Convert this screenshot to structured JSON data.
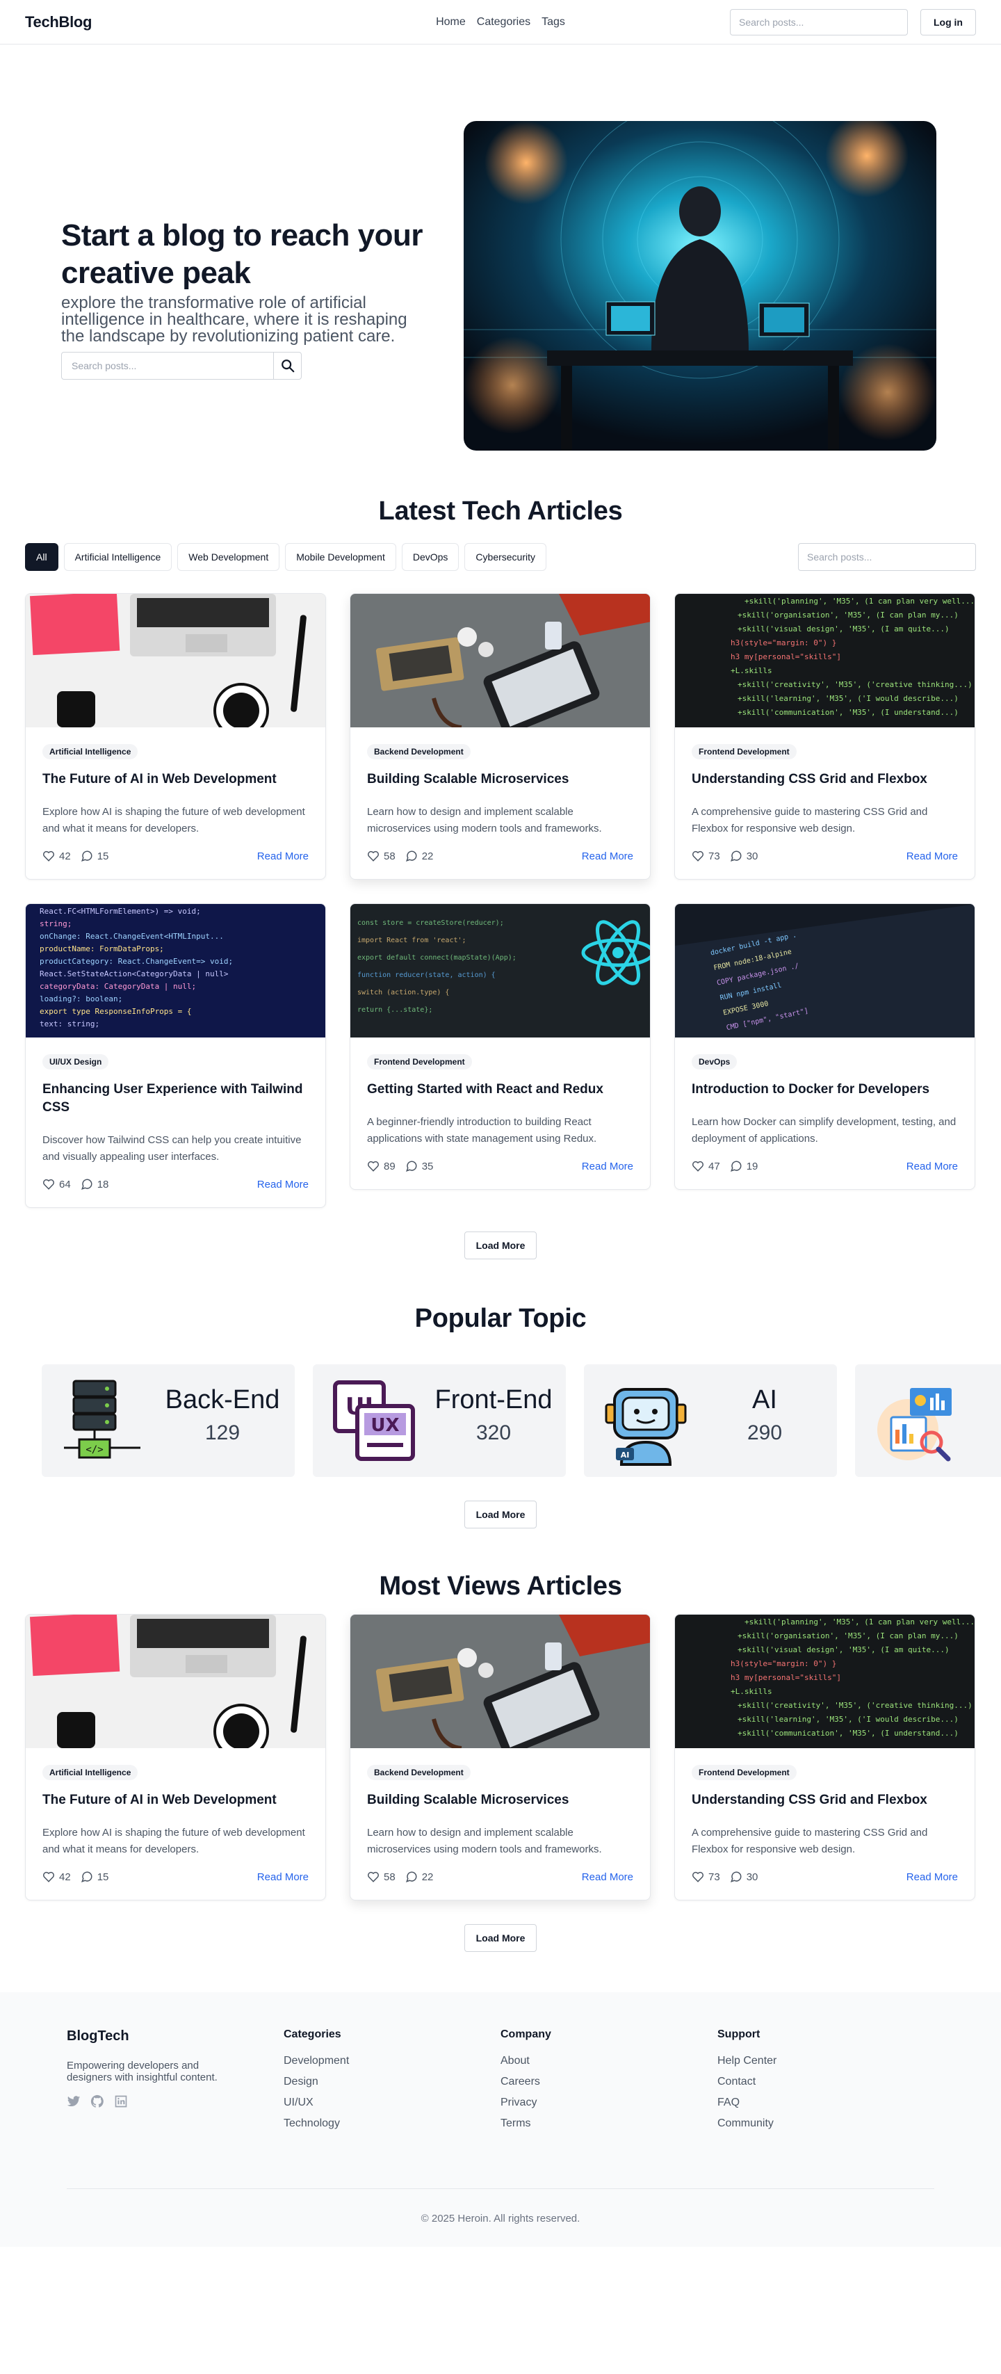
{
  "nav": {
    "brand": "TechBlog",
    "links": [
      "Home",
      "Categories",
      "Tags"
    ],
    "search_placeholder": "Search posts...",
    "login": "Log in"
  },
  "hero": {
    "title": "Start a blog to reach your creative peak",
    "subtitle": "explore the transformative role of artificial intelligence in healthcare, where it is reshaping the landscape by revolutionizing patient care.",
    "search_placeholder": "Search posts..."
  },
  "latest": {
    "title": "Latest Tech Articles",
    "filters": [
      "All",
      "Artificial Intelligence",
      "Web Development",
      "Mobile Development",
      "DevOps",
      "Cybersecurity"
    ],
    "search_placeholder": "Search posts...",
    "load_more": "Load More",
    "articles": [
      {
        "category": "Artificial Intelligence",
        "title": "The Future of AI in Web Development",
        "excerpt": "Explore how AI is shaping the future of web development and what it means for developers.",
        "likes": "42",
        "comments": "15",
        "read": "Read More"
      },
      {
        "category": "Backend Development",
        "title": "Building Scalable Microservices",
        "excerpt": "Learn how to design and implement scalable microservices using modern tools and frameworks.",
        "likes": "58",
        "comments": "22",
        "read": "Read More"
      },
      {
        "category": "Frontend Development",
        "title": "Understanding CSS Grid and Flexbox",
        "excerpt": "A comprehensive guide to mastering CSS Grid and Flexbox for responsive web design.",
        "likes": "73",
        "comments": "30",
        "read": "Read More"
      },
      {
        "category": "UI/UX Design",
        "title": "Enhancing User Experience with Tailwind CSS",
        "excerpt": "Discover how Tailwind CSS can help you create intuitive and visually appealing user interfaces.",
        "likes": "64",
        "comments": "18",
        "read": "Read More"
      },
      {
        "category": "Frontend Development",
        "title": "Getting Started with React and Redux",
        "excerpt": "A beginner-friendly introduction to building React applications with state management using Redux.",
        "likes": "89",
        "comments": "35",
        "read": "Read More"
      },
      {
        "category": "DevOps",
        "title": "Introduction to Docker for Developers",
        "excerpt": "Learn how Docker can simplify development, testing, and deployment of applications.",
        "likes": "47",
        "comments": "19",
        "read": "Read More"
      }
    ]
  },
  "popular": {
    "title": "Popular Topic",
    "load_more": "Load More",
    "topics": [
      {
        "name": "Back-End",
        "count": "129",
        "icon": "server-icon"
      },
      {
        "name": "Front-End",
        "count": "320",
        "icon": "ui-ux-icon"
      },
      {
        "name": "AI",
        "count": "290",
        "icon": "robot-icon"
      },
      {
        "name": "",
        "count": "",
        "icon": "analytics-icon"
      }
    ]
  },
  "most_views": {
    "title": "Most Views Articles",
    "load_more": "Load More",
    "articles": [
      {
        "category": "Artificial Intelligence",
        "title": "The Future of AI in Web Development",
        "excerpt": "Explore how AI is shaping the future of web development and what it means for developers.",
        "likes": "42",
        "comments": "15",
        "read": "Read More"
      },
      {
        "category": "Backend Development",
        "title": "Building Scalable Microservices",
        "excerpt": "Learn how to design and implement scalable microservices using modern tools and frameworks.",
        "likes": "58",
        "comments": "22",
        "read": "Read More"
      },
      {
        "category": "Frontend Development",
        "title": "Understanding CSS Grid and Flexbox",
        "excerpt": "A comprehensive guide to mastering CSS Grid and Flexbox for responsive web design.",
        "likes": "73",
        "comments": "30",
        "read": "Read More"
      }
    ]
  },
  "footer": {
    "brand": "BlogTech",
    "tagline": "Empowering developers and designers with insightful content.",
    "socials": [
      "twitter-icon",
      "github-icon",
      "linkedin-icon"
    ],
    "columns": [
      {
        "title": "Categories",
        "items": [
          "Development",
          "Design",
          "UI/UX",
          "Technology"
        ]
      },
      {
        "title": "Company",
        "items": [
          "About",
          "Careers",
          "Privacy",
          "Terms"
        ]
      },
      {
        "title": "Support",
        "items": [
          "Help Center",
          "Contact",
          "FAQ",
          "Community"
        ]
      }
    ],
    "copyright": "© 2025 Heroin. All rights reserved."
  },
  "colors": {
    "accent": "#2563eb",
    "dark": "#111827",
    "muted": "#4b5563",
    "surface": "#f3f4f6"
  }
}
